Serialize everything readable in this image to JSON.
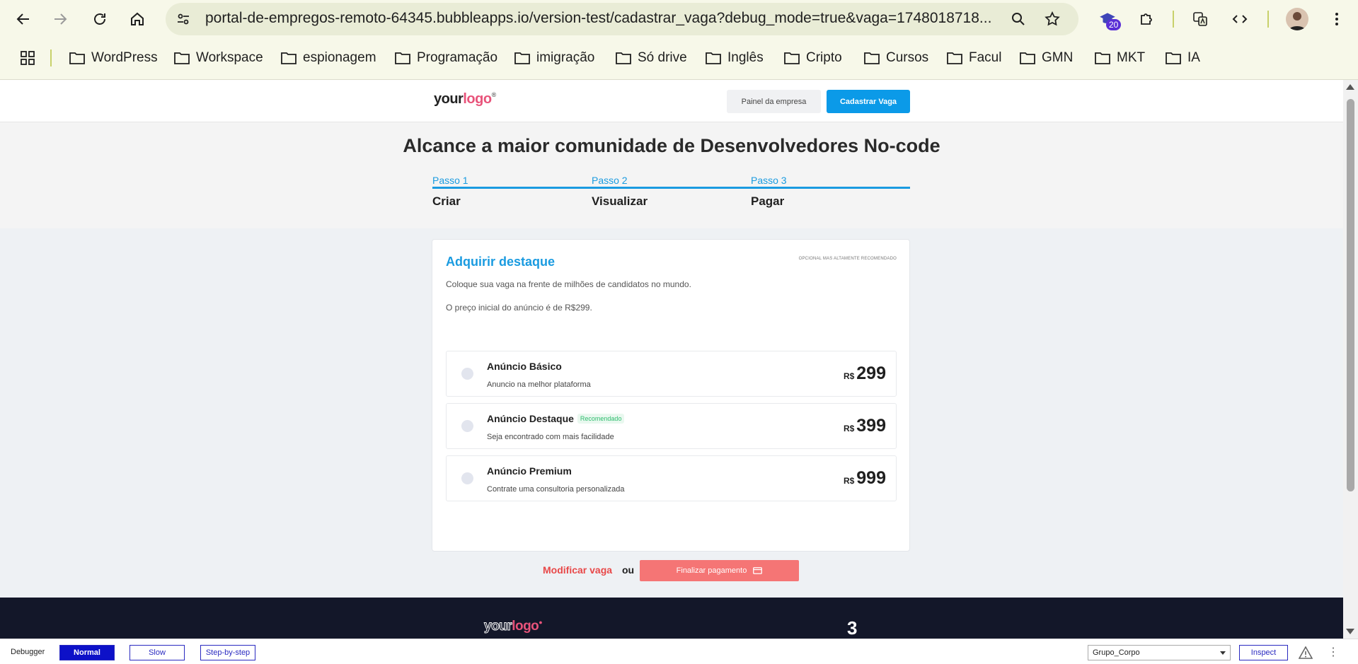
{
  "browser": {
    "url": "portal-de-empregos-remoto-64345.bubbleapps.io/version-test/cadastrar_vaga?debug_mode=true&vaga=1748018718...",
    "extension_badge": "20",
    "bookmarks": [
      "WordPress",
      "Workspace",
      "espionagem",
      "Programação",
      "imigração",
      "Só drive",
      "Inglês",
      "Cripto",
      "Cursos",
      "Facul",
      "GMN",
      "MKT",
      "IA"
    ]
  },
  "header": {
    "logo_part1": "your",
    "logo_part2": "logo",
    "logo_mark": "®",
    "panel_button": "Painel da empresa",
    "post_job_button": "Cadastrar Vaga"
  },
  "hero": {
    "title": "Alcance a maior comunidade de Desenvolvedores No-code",
    "steps": [
      {
        "label": "Passo 1",
        "name": "Criar"
      },
      {
        "label": "Passo 2",
        "name": "Visualizar"
      },
      {
        "label": "Passo 3",
        "name": "Pagar"
      }
    ]
  },
  "card": {
    "title": "Adquirir destaque",
    "tag": "OPCIONAL MAS ALTAMENTE RECOMENDADO",
    "description": "Coloque sua vaga na frente de milhões de candidatos no mundo.",
    "price_note": "O preço inicial do anúncio é de R$299.",
    "options": [
      {
        "title": "Anúncio Básico",
        "badge": "",
        "subtitle": "Anuncio na melhor plataforma",
        "currency": "R$",
        "price": "299"
      },
      {
        "title": "Anúncio Destaque",
        "badge": "Recomendado",
        "subtitle": "Seja encontrado com mais facilidade",
        "currency": "R$",
        "price": "399"
      },
      {
        "title": "Anúncio Premium",
        "badge": "",
        "subtitle": "Contrate uma consultoria personalizada",
        "currency": "R$",
        "price": "999"
      }
    ]
  },
  "actions": {
    "modify": "Modificar vaga",
    "or": "ou",
    "finish": "Finalizar pagamento"
  },
  "footer": {
    "logo_part1": "your",
    "logo_part2": "logo",
    "number": "3"
  },
  "debugger": {
    "label": "Debugger",
    "normal": "Normal",
    "slow": "Slow",
    "step": "Step-by-step",
    "selected_element": "Grupo_Corpo",
    "inspect": "Inspect"
  },
  "colors": {
    "accent": "#1a9be0",
    "cta": "#0b9ae8",
    "danger": "#e84848",
    "pay_button": "#f57575",
    "footer_bg": "#131729",
    "debugger_active": "#0d11c8"
  }
}
